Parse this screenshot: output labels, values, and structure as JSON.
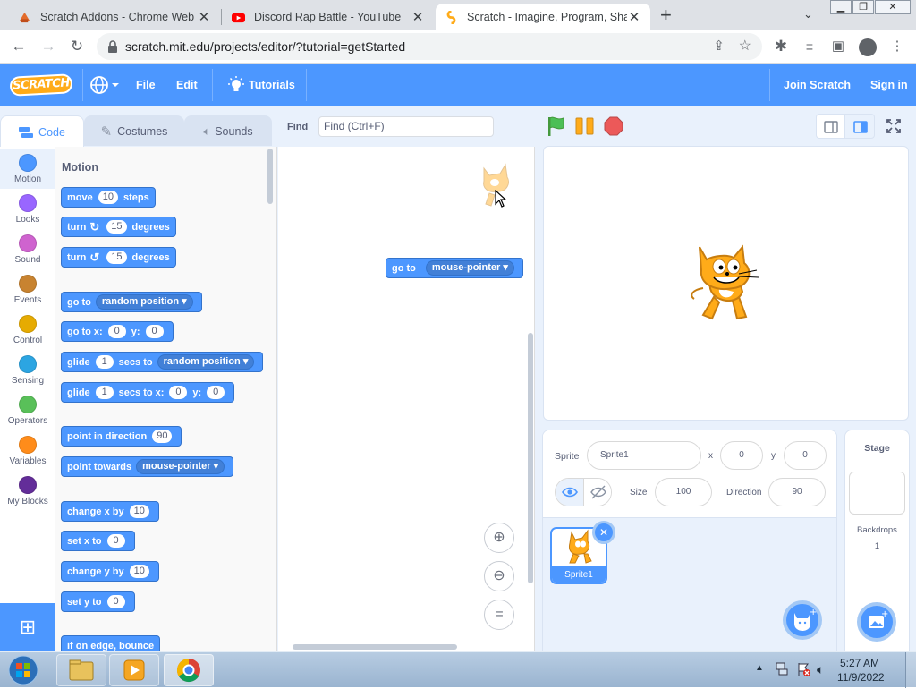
{
  "browser": {
    "tabs": [
      {
        "title": "Scratch Addons - Chrome Web St",
        "icon": "scratch-addons-icon"
      },
      {
        "title": "Discord Rap Battle - YouTube",
        "icon": "youtube-icon"
      },
      {
        "title": "Scratch - Imagine, Program, Shar",
        "icon": "scratch-icon",
        "active": true
      }
    ],
    "url": "scratch.mit.edu/projects/editor/?tutorial=getStarted"
  },
  "menubar": {
    "logo": "SCRATCH",
    "file": "File",
    "edit": "Edit",
    "tutorials": "Tutorials",
    "join": "Join Scratch",
    "signin": "Sign in"
  },
  "editor_tabs": {
    "code": "Code",
    "costumes": "Costumes",
    "sounds": "Sounds"
  },
  "find": {
    "label": "Find",
    "placeholder": "Find (Ctrl+F)"
  },
  "categories": [
    {
      "label": "Motion",
      "color": "#4c97ff"
    },
    {
      "label": "Looks",
      "color": "#9966ff"
    },
    {
      "label": "Sound",
      "color": "#cf63cf"
    },
    {
      "label": "Events",
      "color": "#ffbf00"
    },
    {
      "label": "Control",
      "color": "#ffab19"
    },
    {
      "label": "Sensing",
      "color": "#5cb1d6"
    },
    {
      "label": "Operators",
      "color": "#59c059"
    },
    {
      "label": "Variables",
      "color": "#ff8c1a"
    },
    {
      "label": "My Blocks",
      "color": "#ff6680"
    }
  ],
  "palette": {
    "heading": "Motion",
    "move": {
      "a": "move",
      "v": "10",
      "b": "steps"
    },
    "turn_right": {
      "a": "turn",
      "v": "15",
      "b": "degrees"
    },
    "turn_left": {
      "a": "turn",
      "v": "15",
      "b": "degrees"
    },
    "goto": {
      "a": "go to",
      "dd": "random position"
    },
    "goto_xy": {
      "a": "go to x:",
      "x": "0",
      "b": "y:",
      "y": "0"
    },
    "glide": {
      "a": "glide",
      "v": "1",
      "b": "secs to",
      "dd": "random position"
    },
    "glide_xy": {
      "a": "glide",
      "v": "1",
      "b": "secs to x:",
      "x": "0",
      "c": "y:",
      "y": "0"
    },
    "point_dir": {
      "a": "point in direction",
      "v": "90"
    },
    "point_towards": {
      "a": "point towards",
      "dd": "mouse-pointer"
    },
    "change_x": {
      "a": "change x by",
      "v": "10"
    },
    "set_x": {
      "a": "set x to",
      "v": "0"
    },
    "change_y": {
      "a": "change y by",
      "v": "10"
    },
    "set_y": {
      "a": "set y to",
      "v": "0"
    },
    "bounce": {
      "a": "if on edge, bounce"
    }
  },
  "workspace": {
    "block": {
      "a": "go to",
      "dd": "mouse-pointer"
    },
    "zoom_reset": "="
  },
  "sprite_info": {
    "sprite_label": "Sprite",
    "sprite_name": "Sprite1",
    "x_label": "x",
    "x": "0",
    "y_label": "y",
    "y": "0",
    "size_label": "Size",
    "size": "100",
    "direction_label": "Direction",
    "direction": "90"
  },
  "sprite_list": [
    {
      "name": "Sprite1"
    }
  ],
  "stage_pane": {
    "title": "Stage",
    "backdrops_label": "Backdrops",
    "backdrops_count": "1"
  },
  "taskbar": {
    "time": "5:27 AM",
    "date": "11/9/2022"
  }
}
